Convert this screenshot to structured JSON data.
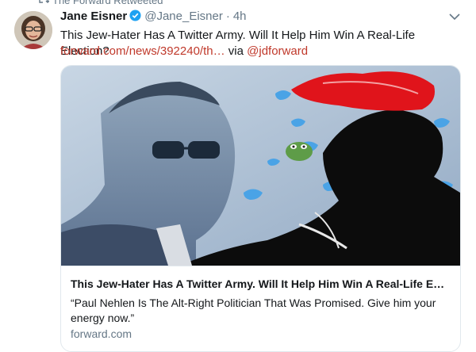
{
  "retweet": {
    "label": "The Forward Retweeted"
  },
  "tweet": {
    "display_name": "Jane Eisner",
    "handle": "@Jane_Eisner",
    "separator": "·",
    "time": "4h",
    "text": "This Jew-Hater Has A Twitter Army. Will It Help Him Win A Real-Life Election?",
    "link": "forward.com/news/392240/th…",
    "via_label": "via",
    "via_handle": "@jdforward"
  },
  "card": {
    "title": "This Jew-Hater Has A Twitter Army. Will It Help Him Win A Real-Life E…",
    "description": "“Paul Nehlen Is The Alt-Right Politician That Was Promised. Give him your energy now.”",
    "domain": "forward.com"
  },
  "colors": {
    "link": "#c0392b",
    "muted": "#657786",
    "verified": "#1da1f2",
    "hat_red": "#e0141b"
  },
  "icons": [
    "retweet-icon",
    "verified-badge-icon",
    "chevron-down-icon"
  ]
}
